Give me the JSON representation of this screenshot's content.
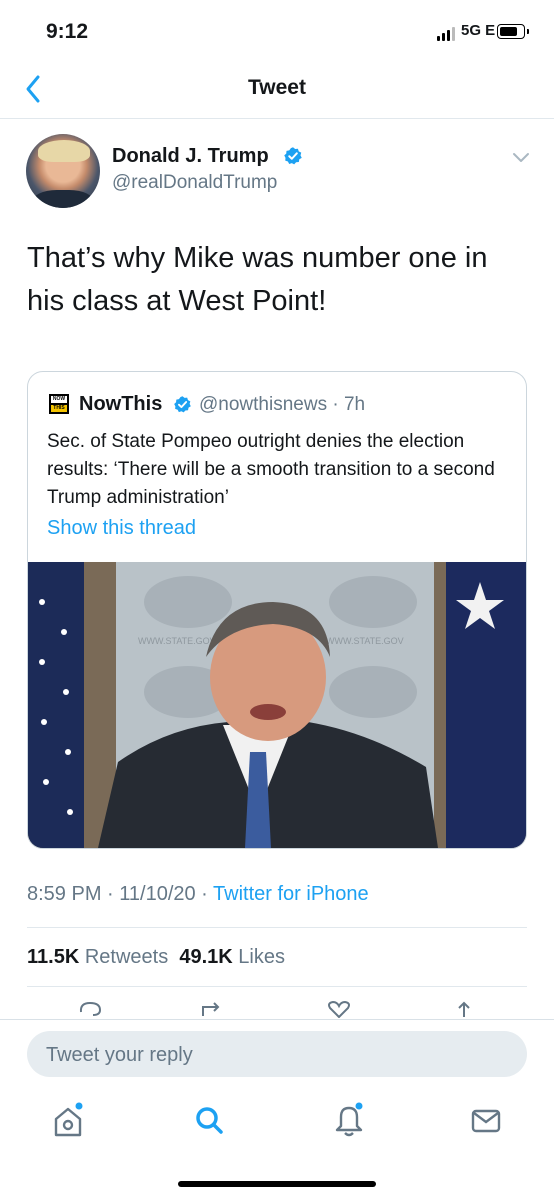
{
  "status_bar": {
    "time": "9:12",
    "network": "5G E"
  },
  "nav": {
    "title": "Tweet",
    "back_icon": "chevron-left-icon"
  },
  "tweet": {
    "author_name": "Donald J. Trump",
    "handle": "@realDonaldTrump",
    "text": "That’s why Mike was number one in his class at West Point!",
    "timestamp": "8:59 PM · 11/10/20 · ",
    "source": "Twitter for iPhone",
    "retweets_count": "11.5K",
    "retweets_label": "Retweets",
    "likes_count": "49.1K",
    "likes_label": "Likes"
  },
  "quote": {
    "logo_top": "NOW",
    "logo_bottom": "THIS",
    "author_name": "NowThis",
    "handle_time": "@nowthisnews · 7h",
    "text": "Sec. of State Pompeo outright denies the election results: ‘There will be a smooth transition to a second Trump administration’",
    "link": "Show this thread",
    "image_text_1": "WWW.STATE.GOV",
    "image_text_2": "WWW.STATE.GOV"
  },
  "reply": {
    "placeholder": "Tweet your reply"
  },
  "colors": {
    "accent": "#1da1f2",
    "secondary_text": "#657786",
    "divider": "#e1e8ed"
  },
  "tab_bar": [
    "home-icon",
    "search-icon",
    "notifications-icon",
    "messages-icon"
  ],
  "actions": [
    "reply-icon",
    "retweet-icon",
    "like-icon",
    "share-icon"
  ]
}
